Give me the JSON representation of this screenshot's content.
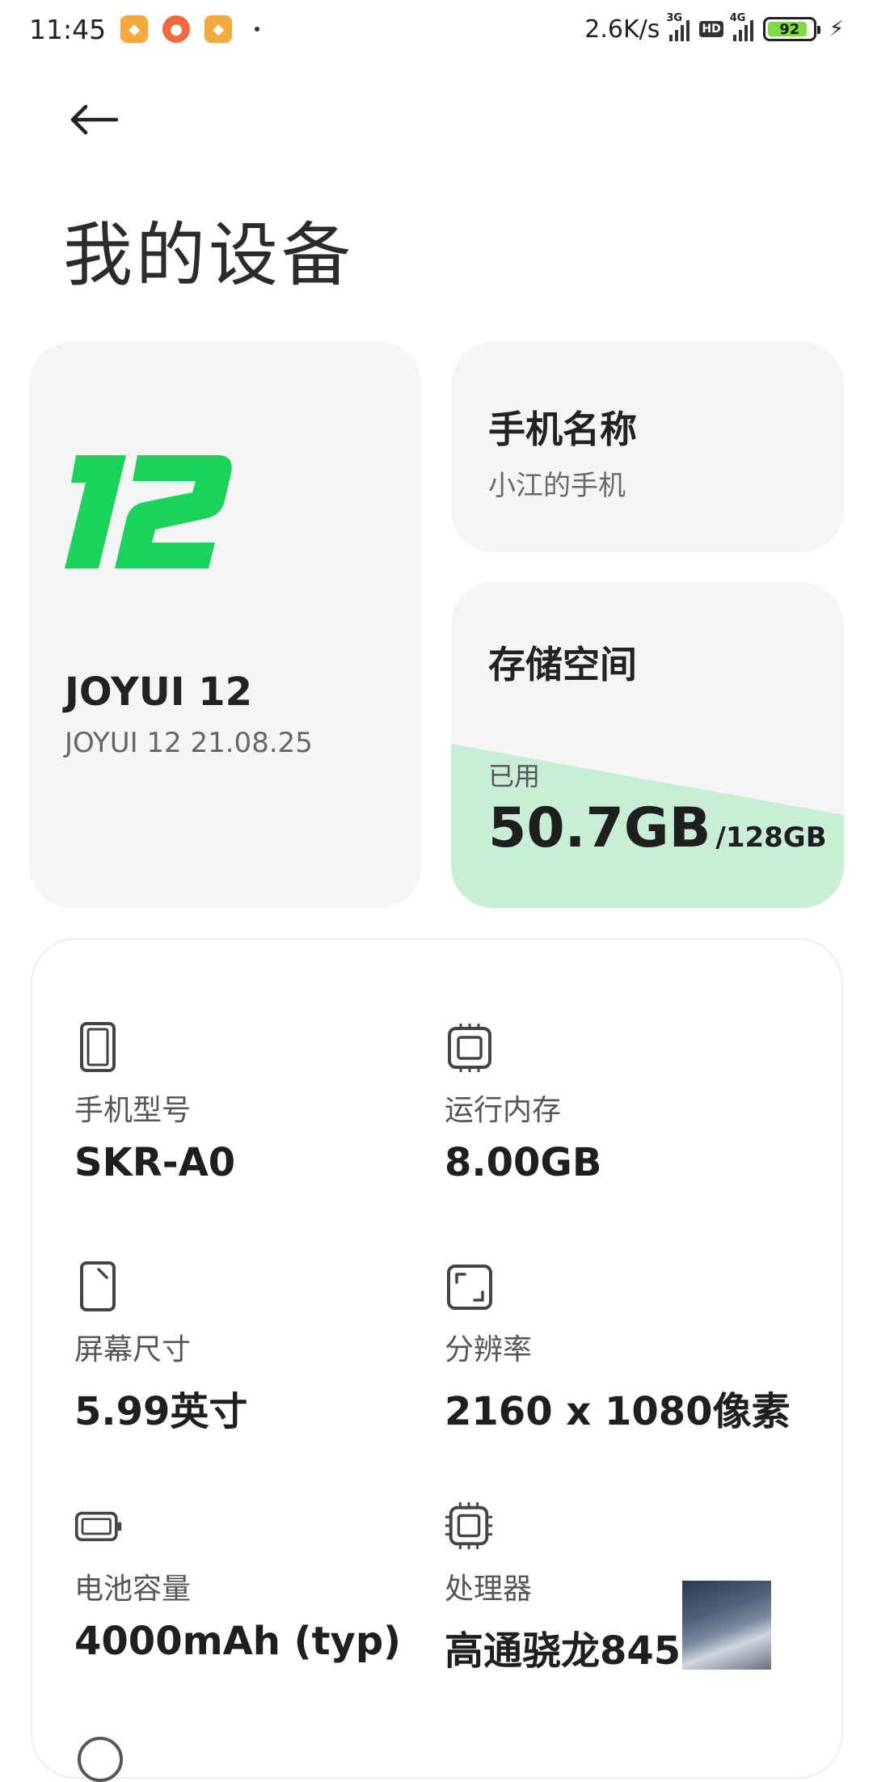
{
  "status_bar": {
    "time": "11:45",
    "net_speed": "2.6K/s",
    "signal1_label": "3G",
    "hd_label": "HD",
    "signal2_label": "4G",
    "battery_level": "92"
  },
  "header": {
    "title": "我的设备"
  },
  "os_card": {
    "logo_text": "12",
    "name": "JOYUI 12",
    "version": "JOYUI 12 21.08.25"
  },
  "name_card": {
    "title": "手机名称",
    "value": "小江的手机"
  },
  "storage_card": {
    "title": "存储空间",
    "used_label": "已用",
    "used": "50.7GB",
    "total": "/128GB",
    "used_fraction": 0.396
  },
  "specs": [
    {
      "icon": "phone-icon",
      "label": "手机型号",
      "value": "SKR-A0"
    },
    {
      "icon": "memory-chip-icon",
      "label": "运行内存",
      "value": "8.00GB"
    },
    {
      "icon": "screen-size-icon",
      "label": "屏幕尺寸",
      "value": "5.99英寸"
    },
    {
      "icon": "resolution-icon",
      "label": "分辨率",
      "value": "2160 x 1080像素"
    },
    {
      "icon": "battery-icon",
      "label": "电池容量",
      "value": "4000mAh (typ)"
    },
    {
      "icon": "processor-icon",
      "label": "处理器",
      "value": "高通骁龙845"
    }
  ],
  "colors": {
    "accent_green": "#19d35a",
    "storage_fill": "#c8efd6",
    "card_bg": "#f5f5f5"
  }
}
